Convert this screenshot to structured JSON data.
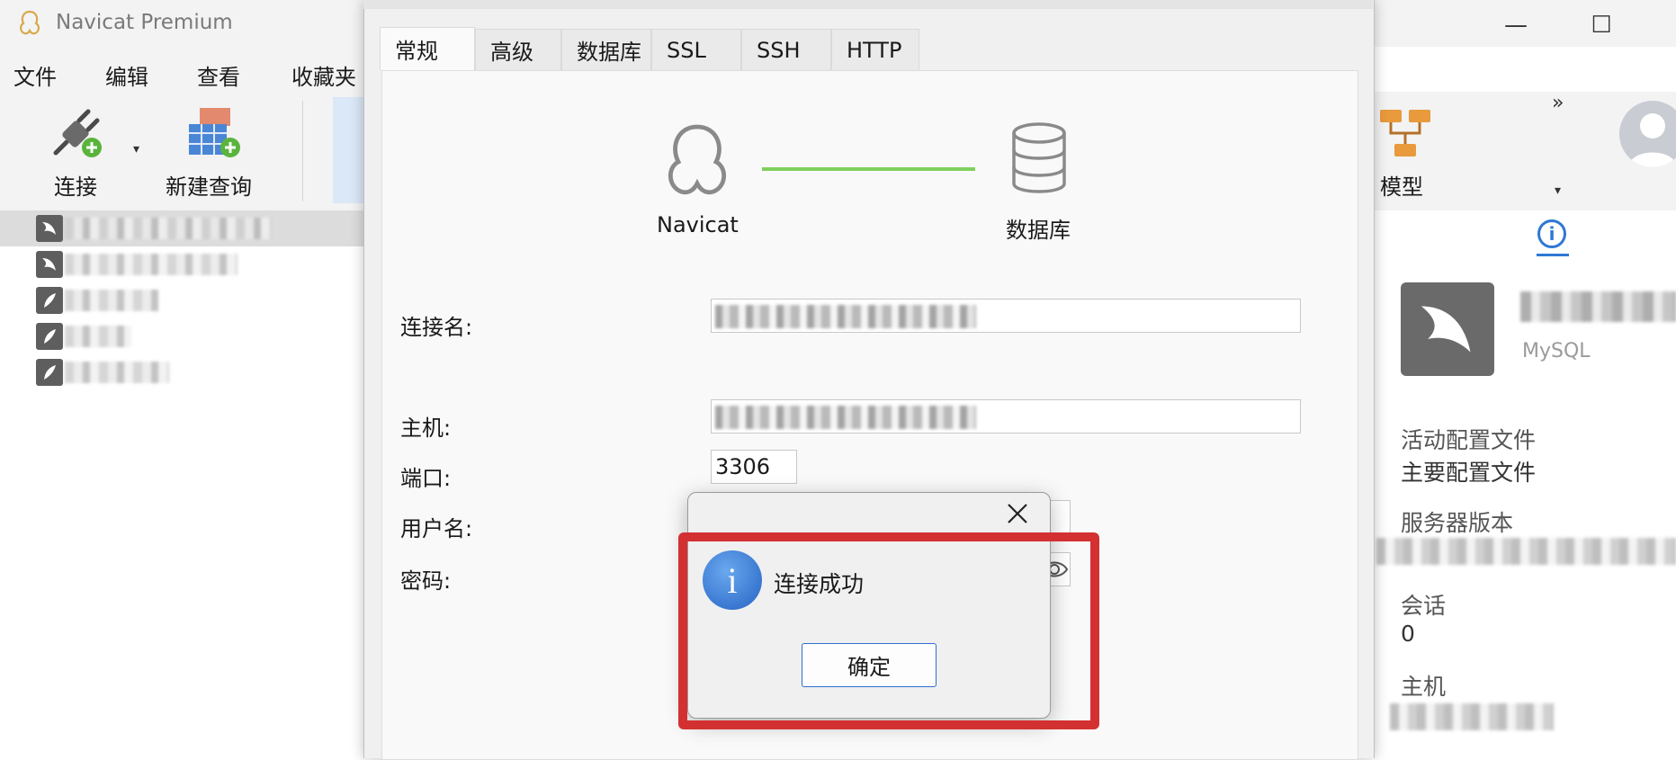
{
  "app": {
    "title": "Navicat Premium"
  },
  "window_controls": {
    "minimize": "—",
    "maximize": "☐"
  },
  "menu": {
    "items": [
      "文件",
      "编辑",
      "查看",
      "收藏夹"
    ]
  },
  "toolbar": {
    "connect_label": "连接",
    "new_query_label": "新建查询",
    "model_label": "模型",
    "overflow": "»"
  },
  "conn_dialog": {
    "tabs": [
      "常规",
      "高级",
      "数据库",
      "SSL",
      "SSH",
      "HTTP"
    ],
    "active_tab": "常规",
    "diagram": {
      "left_label": "Navicat",
      "right_label": "数据库"
    },
    "fields": {
      "connection_name_label": "连接名:",
      "host_label": "主机:",
      "port_label": "端口:",
      "port_value": "3306",
      "username_label": "用户名:",
      "password_label": "密码:"
    }
  },
  "message_box": {
    "message": "连接成功",
    "ok_label": "确定",
    "icon": "info-icon",
    "highlight_color": "#d33131"
  },
  "right_panel": {
    "db_type": "MySQL",
    "active_profile_label": "活动配置文件",
    "active_profile_value": "主要配置文件",
    "server_version_label": "服务器版本",
    "sessions_label": "会话",
    "sessions_value": "0",
    "host_label": "主机"
  },
  "colors": {
    "accent_blue": "#2f6fcf",
    "connection_line": "#7fcf5f",
    "highlight_red": "#d33131",
    "db_icon_bg": "#6a6a6a"
  }
}
